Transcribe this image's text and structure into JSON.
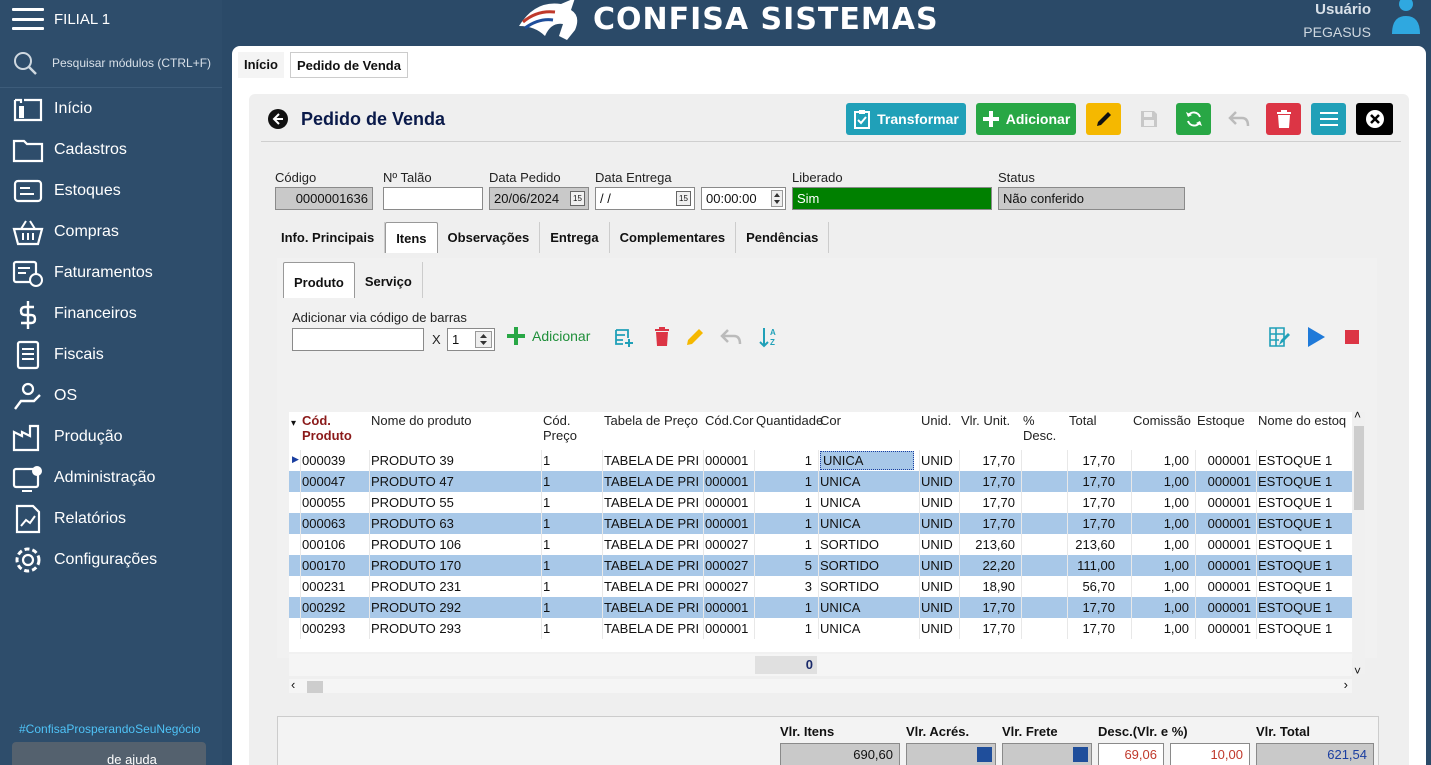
{
  "sidebar": {
    "branch": "FILIAL 1",
    "search_placeholder": "Pesquisar módulos (CTRL+F)",
    "items": [
      {
        "label": "Início",
        "icon": "home-icon"
      },
      {
        "label": "Cadastros",
        "icon": "folder-icon"
      },
      {
        "label": "Estoques",
        "icon": "stock-icon"
      },
      {
        "label": "Compras",
        "icon": "basket-icon"
      },
      {
        "label": "Faturamentos",
        "icon": "invoice-icon"
      },
      {
        "label": "Financeiros",
        "icon": "money-icon"
      },
      {
        "label": "Fiscais",
        "icon": "list-icon"
      },
      {
        "label": "OS",
        "icon": "service-icon"
      },
      {
        "label": "Produção",
        "icon": "factory-icon"
      },
      {
        "label": "Administração",
        "icon": "admin-icon"
      },
      {
        "label": "Relatórios",
        "icon": "report-icon"
      },
      {
        "label": "Configurações",
        "icon": "gear-icon"
      }
    ],
    "hashtag": "#ConfisaProsperandoSeuNegócio",
    "help_label": "de ajuda"
  },
  "header": {
    "brand": "CONFISA SISTEMAS",
    "user_label": "Usuário",
    "user_name": "PEGASUS"
  },
  "tabs": [
    "Início",
    "Pedido de Venda"
  ],
  "page": {
    "title": "Pedido de Venda"
  },
  "toolbar": {
    "transform": "Transformar",
    "add": "Adicionar"
  },
  "fields": {
    "codigo_label": "Código",
    "codigo": "0000001636",
    "talao_label": "Nº Talão",
    "talao": "",
    "data_pedido_label": "Data Pedido",
    "data_pedido": "20/06/2024",
    "data_entrega_label": "Data Entrega",
    "data_entrega": "/ /",
    "hora": "00:00:00",
    "liberado_label": "Liberado",
    "liberado": "Sim",
    "status_label": "Status",
    "status": "Não conferido"
  },
  "section_tabs": [
    "Info. Principais",
    "Itens",
    "Observações",
    "Entrega",
    "Complementares",
    "Pendências"
  ],
  "item_tabs": [
    "Produto",
    "Serviço"
  ],
  "barcode": {
    "label": "Adicionar via código de barras",
    "x": "X",
    "qty": "1",
    "add": "Adicionar"
  },
  "columns": [
    "Cód. Produto",
    "Nome do produto",
    "Cód. Preço",
    "Tabela de Preço",
    "Cód.Cor",
    "Quantidade",
    "Cor",
    "Unid.",
    "Vlr. Unit.",
    "% Desc.",
    "Total",
    "Comissão",
    "Estoque",
    "Nome do estoq"
  ],
  "rows": [
    [
      "000039",
      "PRODUTO 39",
      "1",
      "TABELA DE PRI",
      "000001",
      "1",
      "UNICA",
      "UNID",
      "17,70",
      "",
      "17,70",
      "1,00",
      "000001",
      "ESTOQUE 1"
    ],
    [
      "000047",
      "PRODUTO 47",
      "1",
      "TABELA DE PRI",
      "000001",
      "1",
      "UNICA",
      "UNID",
      "17,70",
      "",
      "17,70",
      "1,00",
      "000001",
      "ESTOQUE 1"
    ],
    [
      "000055",
      "PRODUTO 55",
      "1",
      "TABELA DE PRI",
      "000001",
      "1",
      "UNICA",
      "UNID",
      "17,70",
      "",
      "17,70",
      "1,00",
      "000001",
      "ESTOQUE 1"
    ],
    [
      "000063",
      "PRODUTO 63",
      "1",
      "TABELA DE PRI",
      "000001",
      "1",
      "UNICA",
      "UNID",
      "17,70",
      "",
      "17,70",
      "1,00",
      "000001",
      "ESTOQUE 1"
    ],
    [
      "000106",
      "PRODUTO 106",
      "1",
      "TABELA DE PRI",
      "000027",
      "1",
      "SORTIDO",
      "UNID",
      "213,60",
      "",
      "213,60",
      "1,00",
      "000001",
      "ESTOQUE 1"
    ],
    [
      "000170",
      "PRODUTO 170",
      "1",
      "TABELA DE PRI",
      "000027",
      "5",
      "SORTIDO",
      "UNID",
      "22,20",
      "",
      "111,00",
      "1,00",
      "000001",
      "ESTOQUE 1"
    ],
    [
      "000231",
      "PRODUTO 231",
      "1",
      "TABELA DE PRI",
      "000027",
      "3",
      "SORTIDO",
      "UNID",
      "18,90",
      "",
      "56,70",
      "1,00",
      "000001",
      "ESTOQUE 1"
    ],
    [
      "000292",
      "PRODUTO 292",
      "1",
      "TABELA DE PRI",
      "000001",
      "1",
      "UNICA",
      "UNID",
      "17,70",
      "",
      "17,70",
      "1,00",
      "000001",
      "ESTOQUE 1"
    ],
    [
      "000293",
      "PRODUTO 293",
      "1",
      "TABELA DE PRI",
      "000001",
      "1",
      "UNICA",
      "UNID",
      "17,70",
      "",
      "17,70",
      "1,00",
      "000001",
      "ESTOQUE 1"
    ]
  ],
  "footer_sum": "0",
  "totals": {
    "itens_label": "Vlr. Itens",
    "itens": "690,60",
    "acres_label": "Vlr. Acrés.",
    "acres": "",
    "frete_label": "Vlr. Frete",
    "frete": "",
    "desc_label": "Desc.(Vlr. e %)",
    "desc_vlr": "69,06",
    "desc_pct": "10,00",
    "total_label": "Vlr. Total",
    "total": "621,54"
  },
  "colors": {
    "sidebar": "#2e4d6b",
    "accent_teal": "#20a0b8",
    "green": "#28a745",
    "yellow": "#f5b800",
    "red": "#dc3545",
    "liberado_bg": "#008000",
    "row_alt": "#a8c8e8"
  }
}
